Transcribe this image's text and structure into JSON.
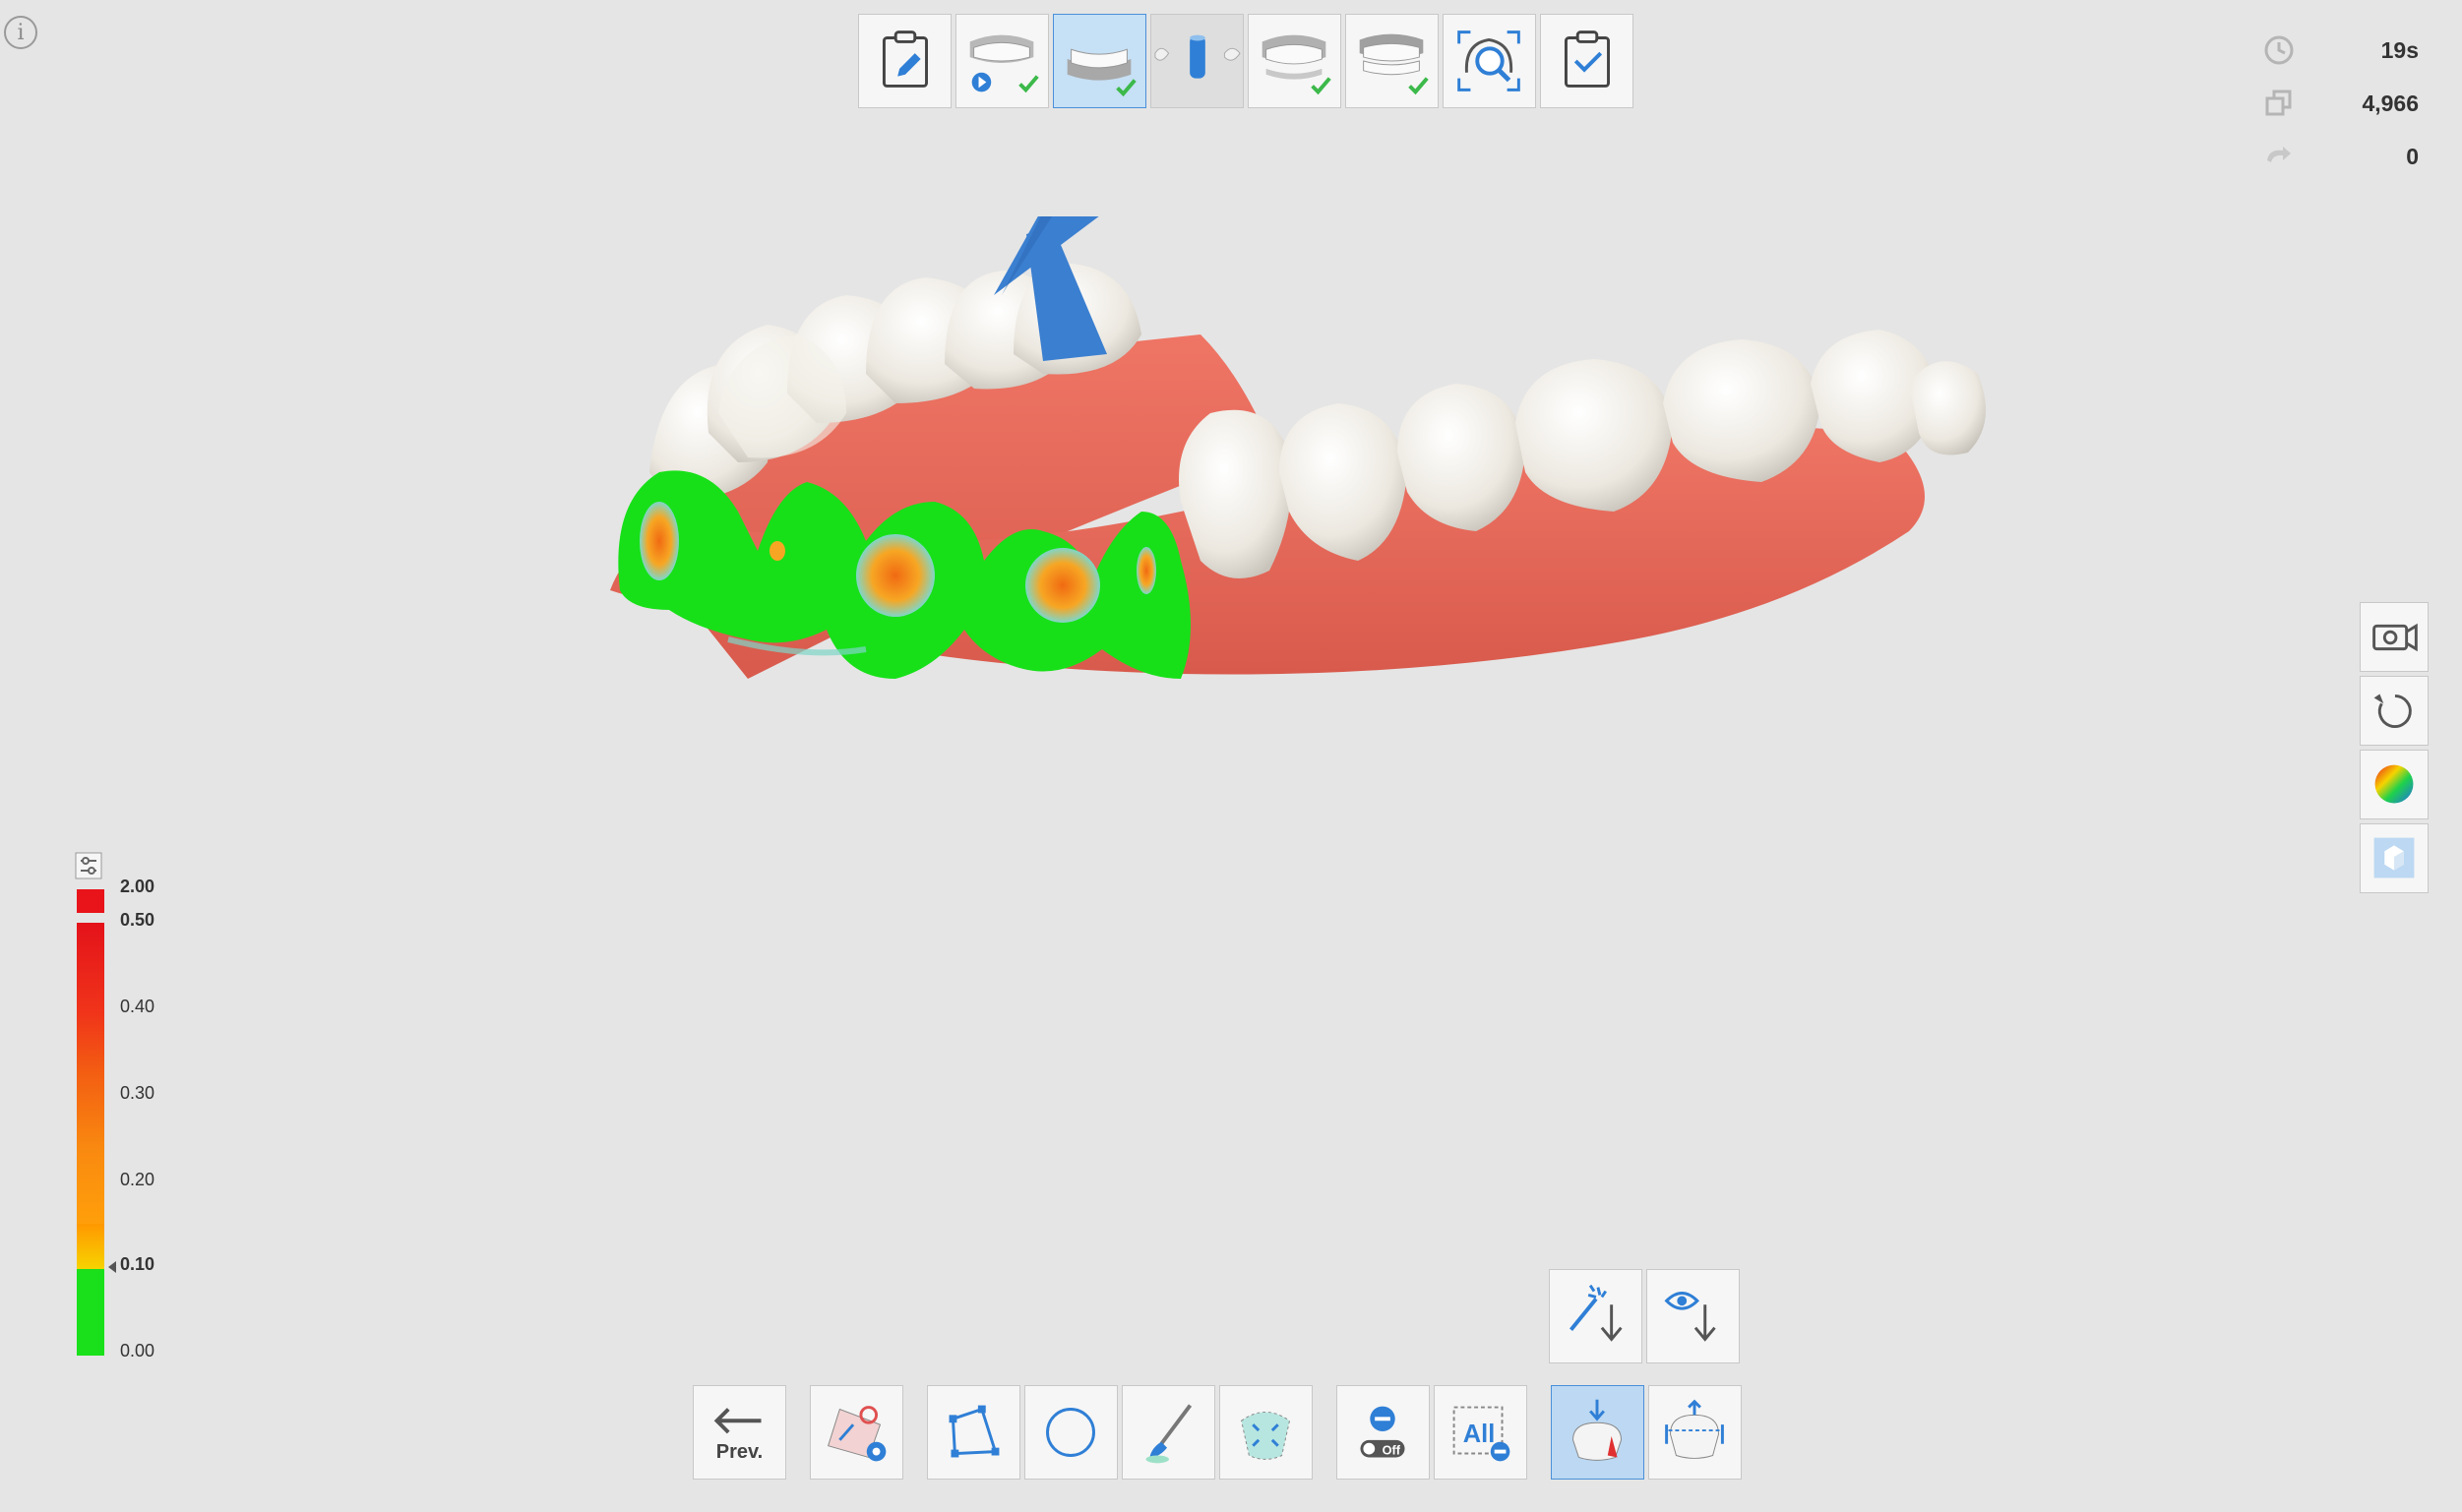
{
  "info": {
    "label": "i",
    "icon": "info-icon"
  },
  "top_toolbar": [
    {
      "name": "notes-tab",
      "icon": "clipboard-pencil-icon",
      "state": "normal"
    },
    {
      "name": "maxilla-prep-tab",
      "icon": "maxilla-play-icon",
      "state": "done"
    },
    {
      "name": "mandible-prep-tab",
      "icon": "mandible-icon",
      "state": "active"
    },
    {
      "name": "scan-body-tab",
      "icon": "scan-body-icon",
      "state": "disabled"
    },
    {
      "name": "maxilla-tab",
      "icon": "maxilla-icon",
      "state": "done"
    },
    {
      "name": "mandible-tab",
      "icon": "mandible-full-icon",
      "state": "done"
    },
    {
      "name": "occlusion-analysis-tab",
      "icon": "occlusion-search-icon",
      "state": "normal"
    },
    {
      "name": "review-tab",
      "icon": "clipboard-check-icon",
      "state": "normal"
    }
  ],
  "stats": {
    "time": "19s",
    "frames": "4,966",
    "rotation": "0"
  },
  "legend": {
    "labels": [
      "2.00",
      "0.50",
      "0.40",
      "0.30",
      "0.20",
      "0.10",
      "0.00"
    ],
    "colors": {
      "red": "#e8141a",
      "orange": "#f98910",
      "yellow": "#f7d300",
      "green": "#19e01a"
    }
  },
  "side_tools": [
    {
      "name": "camera-button",
      "icon": "camera-icon"
    },
    {
      "name": "reset-view-button",
      "icon": "reset-rotate-icon"
    },
    {
      "name": "color-map-button",
      "icon": "color-sphere-icon"
    },
    {
      "name": "solid-view-button",
      "icon": "cube-icon"
    }
  ],
  "bottom_upper": [
    {
      "name": "auto-lock-button",
      "icon": "magic-wand-down-icon"
    },
    {
      "name": "visible-lock-button",
      "icon": "eye-down-icon"
    }
  ],
  "bottom_tools": {
    "prev_label": "Prev.",
    "all_label": "All",
    "off_label": "Off",
    "buttons": [
      "prev-button",
      "model-settings-button",
      "polygon-select-button",
      "circle-select-button",
      "brush-select-button",
      "region-select-button",
      "lock-toggle-button",
      "all-remove-button",
      "undercut-button",
      "margin-button"
    ]
  },
  "colors": {
    "accent": "#2f7fd6",
    "arrow": "#3b7fd0",
    "gum": "#e8685a",
    "tooth": "#eeebe4",
    "check": "#3cb94a"
  }
}
